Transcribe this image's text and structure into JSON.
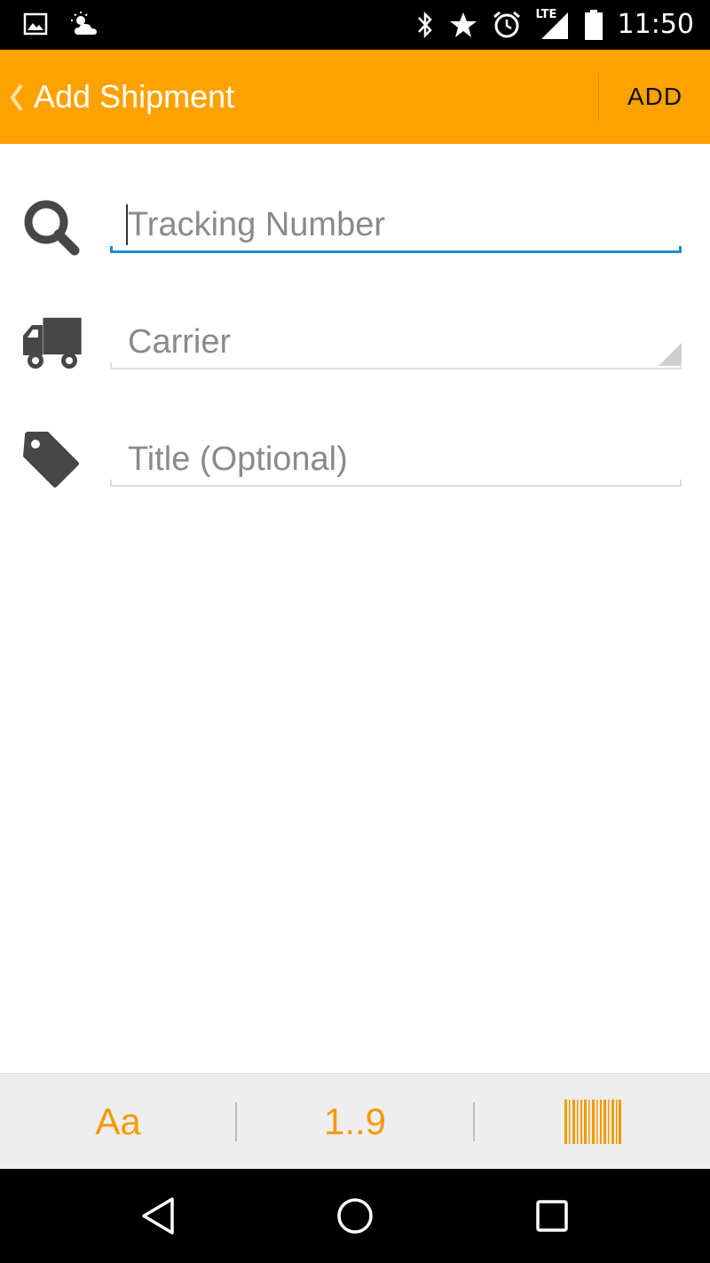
{
  "status_bar": {
    "time": "11:50",
    "network_label": "LTE",
    "icons": [
      "image-notification-icon",
      "weather-icon",
      "bluetooth-icon",
      "star-icon",
      "alarm-icon",
      "lte-signal-icon",
      "battery-icon"
    ]
  },
  "app_bar": {
    "title": "Add Shipment",
    "action_label": "ADD",
    "background_color": "#ffa200"
  },
  "form": {
    "tracking_number": {
      "placeholder": "Tracking Number",
      "value": "",
      "icon": "search-icon"
    },
    "carrier": {
      "placeholder": "Carrier",
      "icon": "truck-icon"
    },
    "title": {
      "placeholder": "Title (Optional)",
      "value": "",
      "icon": "tag-icon"
    },
    "focus_color": "#1a8ecb"
  },
  "input_mode_bar": {
    "text_mode_label": "Aa",
    "numeric_mode_label": "1..9",
    "barcode_icon": "barcode-icon",
    "accent_color": "#f59a00"
  },
  "nav_bar": {
    "buttons": [
      "back-icon",
      "home-icon",
      "recents-icon"
    ]
  }
}
